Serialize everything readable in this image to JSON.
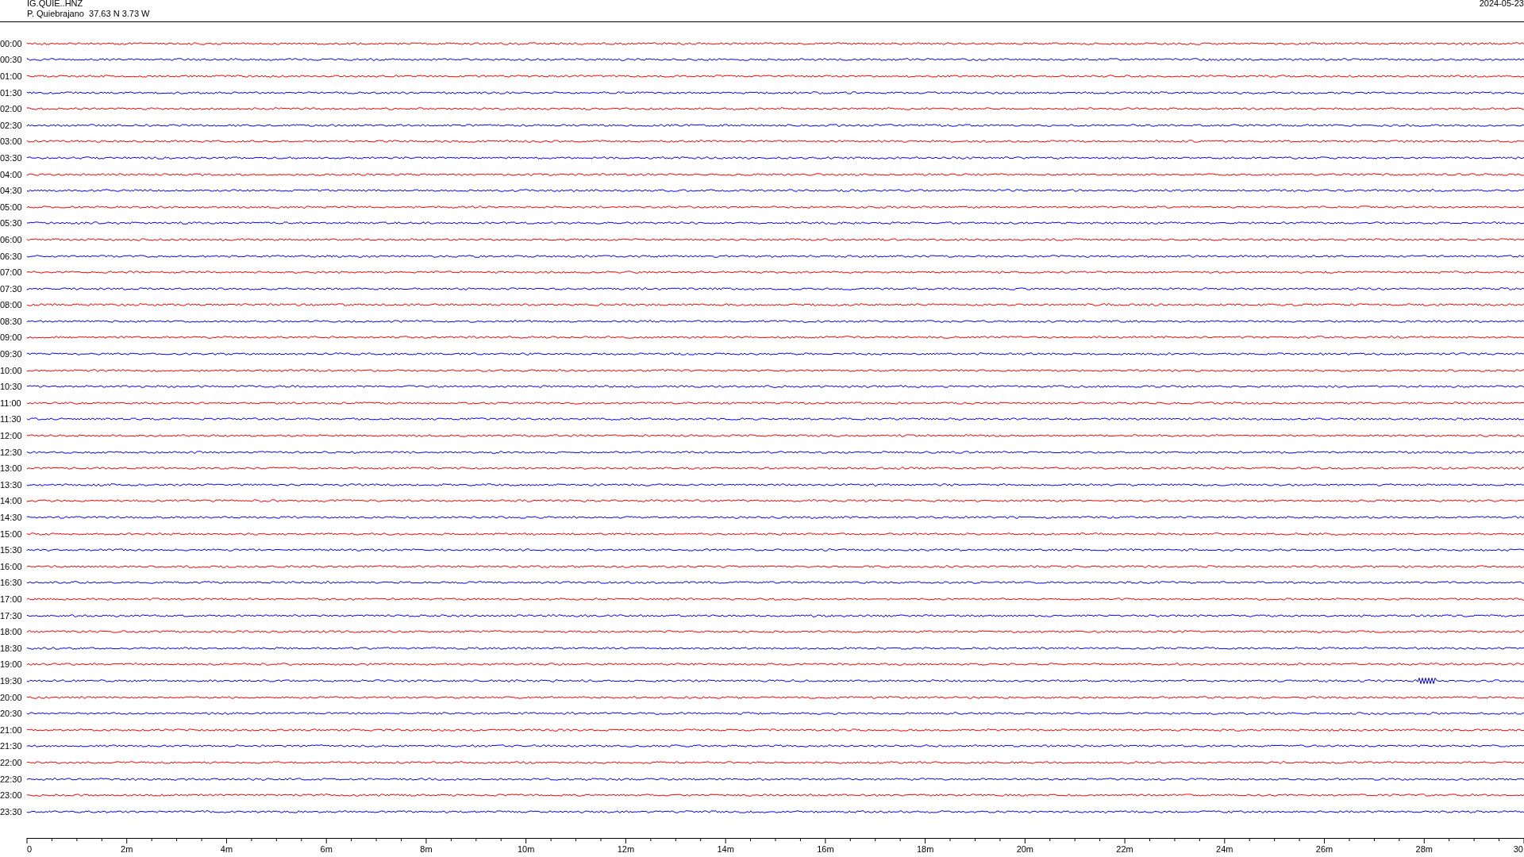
{
  "header": {
    "station": "IG.QUIE..HNZ",
    "location": "P. Quiebrajano  37.63 N 3.73 W",
    "date": "2024-05-23"
  },
  "traces": [
    {
      "label": "00:00",
      "color": "#ff0000",
      "burst": false
    },
    {
      "label": "00:30",
      "color": "#0000ff",
      "burst": false
    },
    {
      "label": "01:00",
      "color": "#ff0000",
      "burst": false
    },
    {
      "label": "01:30",
      "color": "#0000ff",
      "burst": false
    },
    {
      "label": "02:00",
      "color": "#ff0000",
      "burst": false
    },
    {
      "label": "02:30",
      "color": "#0000ff",
      "burst": false
    },
    {
      "label": "03:00",
      "color": "#ff0000",
      "burst": false
    },
    {
      "label": "03:30",
      "color": "#0000ff",
      "burst": false
    },
    {
      "label": "04:00",
      "color": "#ff0000",
      "burst": false
    },
    {
      "label": "04:30",
      "color": "#0000ff",
      "burst": false
    },
    {
      "label": "05:00",
      "color": "#ff0000",
      "burst": false
    },
    {
      "label": "05:30",
      "color": "#0000ff",
      "burst": false
    },
    {
      "label": "06:00",
      "color": "#ff0000",
      "burst": false
    },
    {
      "label": "06:30",
      "color": "#0000ff",
      "burst": false
    },
    {
      "label": "07:00",
      "color": "#ff0000",
      "burst": false
    },
    {
      "label": "07:30",
      "color": "#0000ff",
      "burst": false
    },
    {
      "label": "08:00",
      "color": "#ff0000",
      "burst": false
    },
    {
      "label": "08:30",
      "color": "#0000ff",
      "burst": false
    },
    {
      "label": "09:00",
      "color": "#ff0000",
      "burst": false
    },
    {
      "label": "09:30",
      "color": "#0000ff",
      "burst": false
    },
    {
      "label": "10:00",
      "color": "#ff0000",
      "burst": false
    },
    {
      "label": "10:30",
      "color": "#0000ff",
      "burst": false
    },
    {
      "label": "11:00",
      "color": "#ff0000",
      "burst": false
    },
    {
      "label": "11:30",
      "color": "#0000ff",
      "burst": false
    },
    {
      "label": "12:00",
      "color": "#ff0000",
      "burst": false
    },
    {
      "label": "12:30",
      "color": "#0000ff",
      "burst": false
    },
    {
      "label": "13:00",
      "color": "#ff0000",
      "burst": false
    },
    {
      "label": "13:30",
      "color": "#0000ff",
      "burst": false
    },
    {
      "label": "14:00",
      "color": "#ff0000",
      "burst": false
    },
    {
      "label": "14:30",
      "color": "#0000ff",
      "burst": false
    },
    {
      "label": "15:00",
      "color": "#ff0000",
      "burst": false
    },
    {
      "label": "15:30",
      "color": "#0000ff",
      "burst": false
    },
    {
      "label": "16:00",
      "color": "#ff0000",
      "burst": false
    },
    {
      "label": "16:30",
      "color": "#0000ff",
      "burst": false
    },
    {
      "label": "17:00",
      "color": "#ff0000",
      "burst": false
    },
    {
      "label": "17:30",
      "color": "#0000ff",
      "burst": false
    },
    {
      "label": "18:00",
      "color": "#ff0000",
      "burst": false
    },
    {
      "label": "18:30",
      "color": "#0000ff",
      "burst": false
    },
    {
      "label": "19:00",
      "color": "#ff0000",
      "burst": false
    },
    {
      "label": "19:30",
      "color": "#0000ff",
      "burst": true
    },
    {
      "label": "20:00",
      "color": "#ff0000",
      "burst": false
    },
    {
      "label": "20:30",
      "color": "#0000ff",
      "burst": false
    },
    {
      "label": "21:00",
      "color": "#ff0000",
      "burst": false
    },
    {
      "label": "21:30",
      "color": "#0000ff",
      "burst": false
    },
    {
      "label": "22:00",
      "color": "#ff0000",
      "burst": false
    },
    {
      "label": "22:30",
      "color": "#0000ff",
      "burst": false
    },
    {
      "label": "23:00",
      "color": "#ff0000",
      "burst": false
    },
    {
      "label": "23:30",
      "color": "#0000ff",
      "burst": false
    }
  ],
  "axis": {
    "ticks": [
      "0",
      "2m",
      "4m",
      "6m",
      "8m",
      "10m",
      "12m",
      "14m",
      "16m",
      "18m",
      "20m",
      "22m",
      "24m",
      "26m",
      "28m",
      "30"
    ]
  }
}
